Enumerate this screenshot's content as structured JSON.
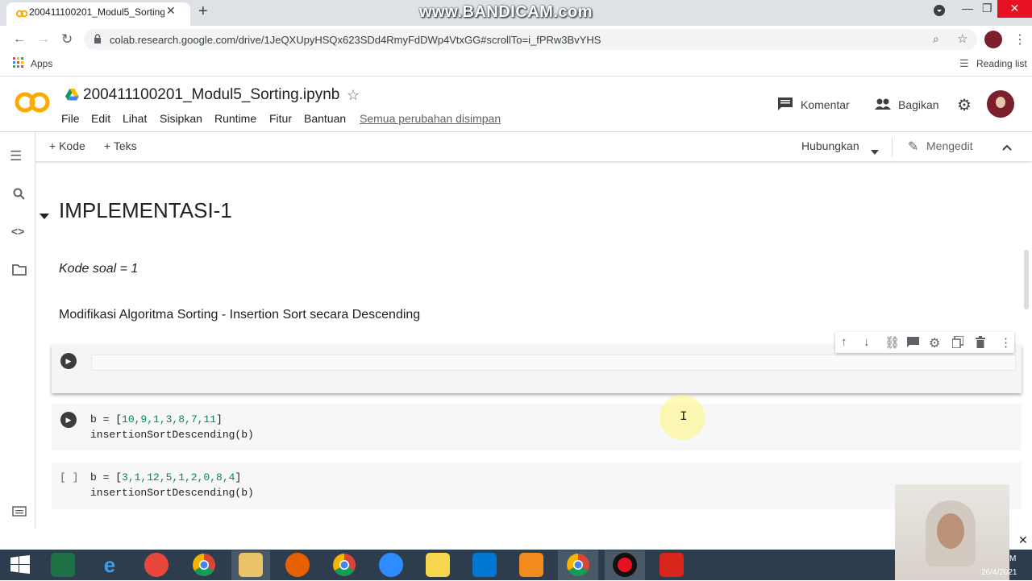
{
  "browser": {
    "tab_title": "200411100201_Modul5_Sorting.i",
    "watermark": "www.BANDICAM.com",
    "url": "colab.research.google.com/drive/1JeQXUpyHSQx623SDd4RmyFdDWp4VtxGG#scrollTo=i_fPRw3BvYHS",
    "apps_label": "Apps",
    "reading_list_label": "Reading list"
  },
  "colab": {
    "logo": "CO",
    "notebook_title": "200411100201_Modul5_Sorting.ipynb",
    "menu": [
      "File",
      "Edit",
      "Lihat",
      "Sisipkan",
      "Runtime",
      "Fitur",
      "Bantuan"
    ],
    "saved_status": "Semua perubahan disimpan",
    "comment_label": "Komentar",
    "share_label": "Bagikan",
    "add_code_label": "+ Kode",
    "add_text_label": "+ Teks",
    "connect_label": "Hubungkan",
    "editing_label": "Mengedit"
  },
  "notebook": {
    "section_heading": "IMPLEMENTASI-1",
    "kode_soal": "Kode soal = 1",
    "description": "Modifikasi Algoritma Sorting - Insertion Sort secara Descending",
    "cells": [
      {
        "line1_prefix": "b = [",
        "line1_values": "10,9,1,3,8,7,11",
        "line1_suffix": "]",
        "line2": "insertionSortDescending(b)"
      },
      {
        "exec_label": "[ ]",
        "line1_prefix": "b = [",
        "line1_values": "3,1,12,5,1,2,0,8,4",
        "line1_suffix": "]",
        "line2": "insertionSortDescending(b)"
      }
    ]
  },
  "taskbar": {
    "clock_top": "M",
    "clock_date": "26/4/2021"
  },
  "colors": {
    "accent_orange": "#f9ab00",
    "tab_bg": "#dee1e6",
    "taskbar_bg": "#2d3d4d",
    "close_red": "#e81123"
  }
}
